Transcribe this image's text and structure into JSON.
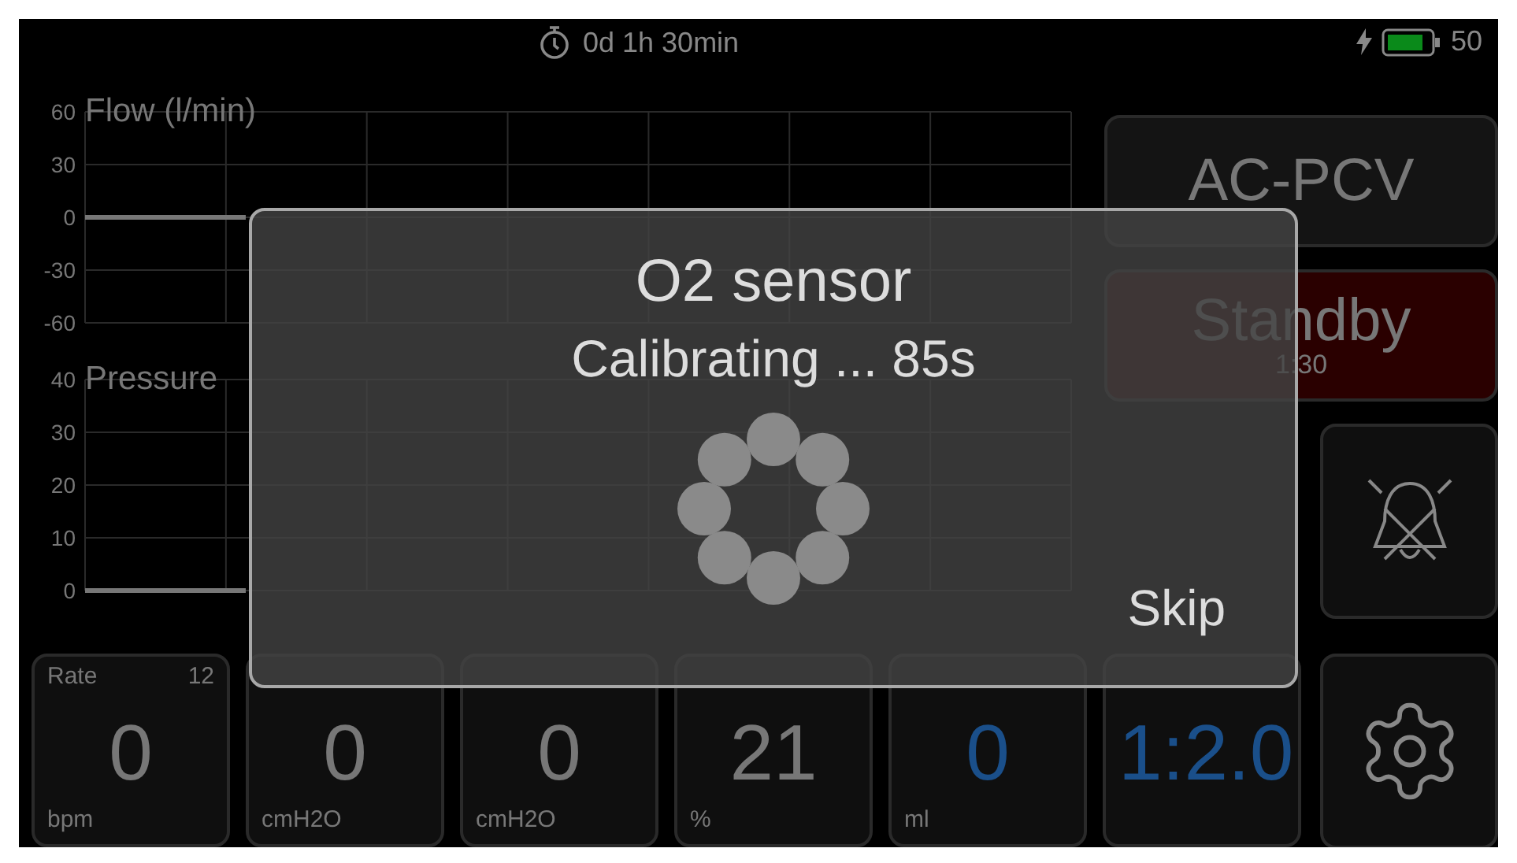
{
  "status_bar": {
    "timer": "0d 1h 30min",
    "charging": true,
    "battery": "50"
  },
  "charts": [
    {
      "title": "Flow (l/min)",
      "axis_labels": [
        "60",
        "30",
        "0",
        "-30",
        "-60"
      ]
    },
    {
      "title": "Pressure",
      "axis_labels": [
        "40",
        "30",
        "20",
        "10",
        "0"
      ]
    }
  ],
  "mode_button": {
    "label": "AC-PCV"
  },
  "standby_button": {
    "label": "Standby",
    "time": "1:30"
  },
  "tiles": [
    {
      "label": "Rate",
      "setting": "12",
      "value": "0",
      "unit": "bpm",
      "color": "#777777"
    },
    {
      "value": "0",
      "unit": "cmH2O",
      "color": "#777777"
    },
    {
      "value": "0",
      "unit": "cmH2O",
      "color": "#777777"
    },
    {
      "value": "21",
      "unit": "%",
      "color": "#777777"
    },
    {
      "value": "0",
      "unit": "ml",
      "color": "#1a4f8a"
    },
    {
      "value": "1:2.0",
      "color": "#1a4f8a"
    }
  ],
  "dialog": {
    "title": "O2 sensor",
    "message": "Calibrating ... 85s",
    "button": "Skip"
  }
}
